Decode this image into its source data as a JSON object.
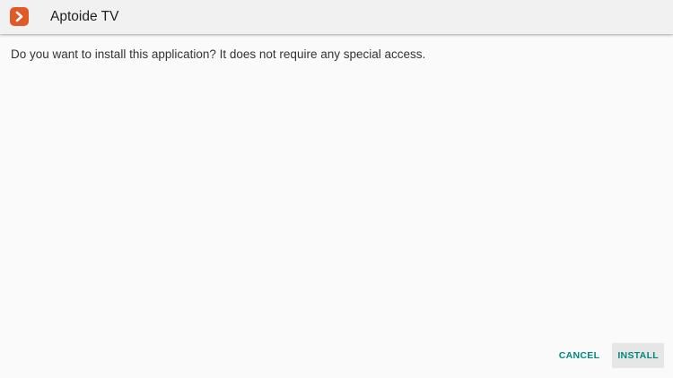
{
  "colors": {
    "accent": "#00897b",
    "app_icon": "#e05a28",
    "title_bar": "#f1f1f1",
    "background": "#fafafa"
  },
  "header": {
    "icon": "aptoide-app-icon",
    "title": "Aptoide TV"
  },
  "main": {
    "message": "Do you want to install this application? It does not require any special access."
  },
  "actions": {
    "cancel_label": "CANCEL",
    "install_label": "INSTALL"
  }
}
